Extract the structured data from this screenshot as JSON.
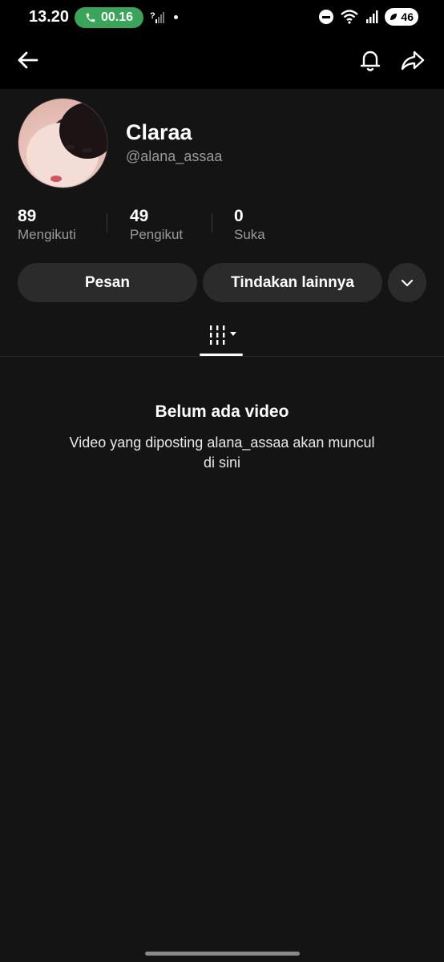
{
  "status_bar": {
    "time": "13.20",
    "call_duration": "00.16",
    "sim_marker": "?",
    "battery": "46",
    "icons": [
      "phone-icon",
      "signal-icon",
      "dnd-icon",
      "wifi-icon",
      "battery-icon"
    ]
  },
  "top_bar": {
    "icons": [
      "back-arrow-icon",
      "bell-icon",
      "share-icon"
    ]
  },
  "profile": {
    "display_name": "Claraa",
    "username": "@alana_assaa"
  },
  "stats": {
    "following_count": "89",
    "following_label": "Mengikuti",
    "followers_count": "49",
    "followers_label": "Pengikut",
    "likes_count": "0",
    "likes_label": "Suka"
  },
  "actions": {
    "message_label": "Pesan",
    "more_actions_label": "Tindakan lainnya",
    "dropdown_icon": "chevron-down-icon"
  },
  "tabs": {
    "active": "videos-grid",
    "icon": "grid-filter-icon"
  },
  "empty_state": {
    "title": "Belum ada video",
    "description_line1": "Video yang diposting alana_assaa akan muncul",
    "description_line2": "di sini"
  },
  "colors": {
    "background": "#141414",
    "bar_background": "#000000",
    "button_background": "#2b2b2b",
    "call_pill": "#3aa55a",
    "secondary_text": "#9a9a9a"
  }
}
